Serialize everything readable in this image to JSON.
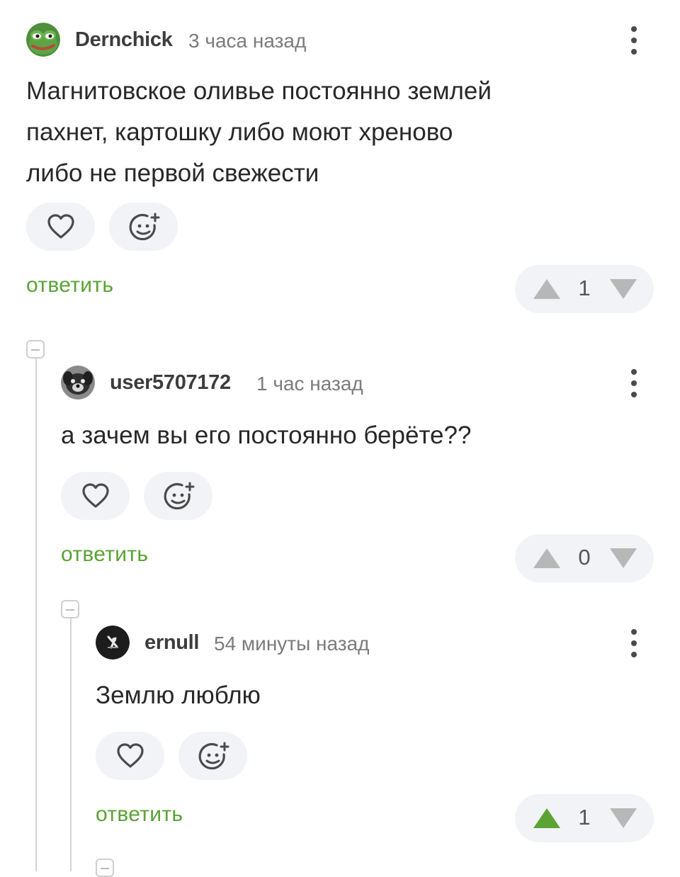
{
  "comments": [
    {
      "author": "Dernchick",
      "time": "3 часа назад",
      "lines": [
        "Магнитовское оливье постоянно землей",
        "пахнет, картошку либо моют хреново",
        "либо не первой свежести"
      ],
      "reply_label": "ответить",
      "rating": "1",
      "avatar": "pepe-frog-avatar"
    },
    {
      "author": "user5707172",
      "time": "1 час назад",
      "lines": [
        "а зачем вы его постоянно берёте??"
      ],
      "reply_label": "ответить",
      "rating": "0",
      "avatar": "dog-photo-avatar"
    },
    {
      "author": "ernull",
      "time": "54 минуты назад",
      "lines": [
        "Землю люблю"
      ],
      "reply_label": "ответить",
      "rating": "1",
      "rating_upvoted": true,
      "avatar": "dark-figure-avatar"
    }
  ],
  "icons": {
    "like": "heart-icon",
    "react": "add-emoji-icon",
    "menu": "more-vertical-icon",
    "upvote": "triangle-up-icon",
    "downvote": "triangle-down-icon",
    "collapse": "collapse-thread-icon"
  },
  "colors": {
    "accent_green": "#5aa334",
    "vote_gray": "#b7b7b7",
    "pill_bg": "#f2f3f6"
  }
}
